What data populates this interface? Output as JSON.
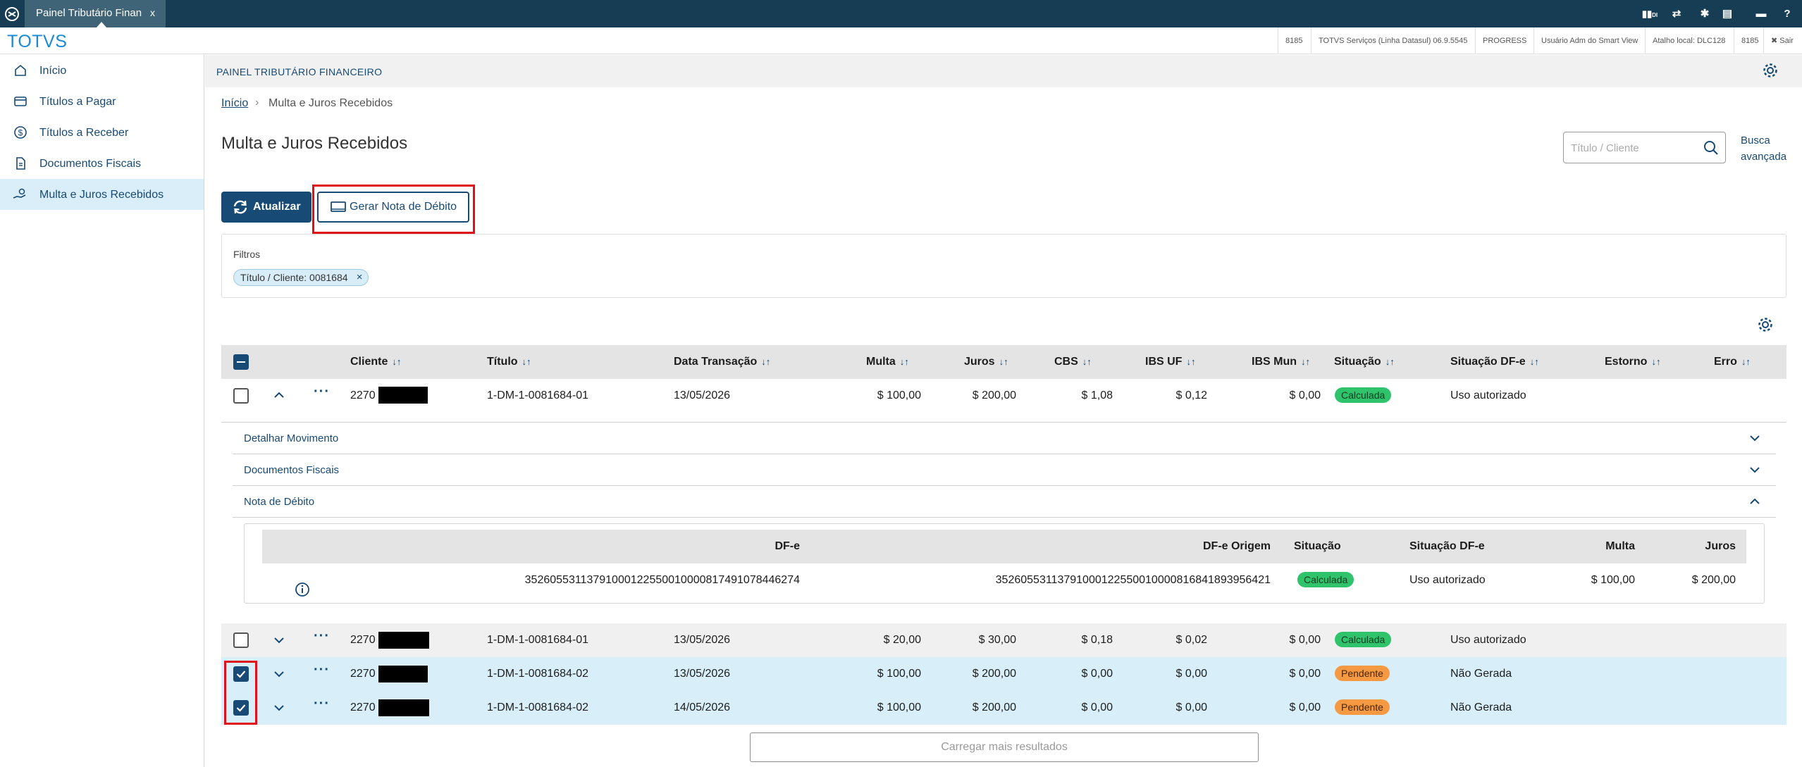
{
  "window": {
    "tab_title": "Painel Tributário Finan",
    "tab_close": "x"
  },
  "topbar_icons": [
    "signal-icon",
    "shuffle-icon",
    "gear-icon",
    "document-icon",
    "chat-icon",
    "help-icon"
  ],
  "topbar_signal_label": "DI",
  "header": {
    "logo": "TOTVS",
    "info": [
      "8185",
      "TOTVS Serviços (Linha Datasul) 06.9.5545",
      "PROGRESS",
      "Usuário Adm do Smart View",
      "Atalho local: DLC128",
      "8185",
      "Sair"
    ]
  },
  "sidebar": {
    "items": [
      {
        "label": "Início",
        "icon": "home-icon"
      },
      {
        "label": "Títulos a Pagar",
        "icon": "wallet-icon"
      },
      {
        "label": "Títulos a Receber",
        "icon": "dollar-icon"
      },
      {
        "label": "Documentos Fiscais",
        "icon": "document-icon"
      },
      {
        "label": "Multa e Juros Recebidos",
        "icon": "hand-money-icon"
      }
    ]
  },
  "page": {
    "section_title": "PAINEL TRIBUTÁRIO FINANCEIRO",
    "breadcrumb": {
      "home": "Início",
      "current": "Multa e Juros Recebidos"
    },
    "title": "Multa e Juros Recebidos",
    "search_placeholder": "Título / Cliente",
    "advanced_search": "Busca avançada",
    "buttons": {
      "refresh": "Atualizar",
      "generate": "Gerar Nota de Débito"
    },
    "filters": {
      "label": "Filtros",
      "chip": "Título / Cliente: 0081684"
    },
    "load_more": "Carregar mais resultados"
  },
  "table": {
    "columns": [
      "Cliente",
      "Título",
      "Data Transação",
      "Multa",
      "Juros",
      "CBS",
      "IBS UF",
      "IBS Mun",
      "Situação",
      "Situação DF-e",
      "Estorno",
      "Erro"
    ],
    "rows": [
      {
        "cliente": "2270",
        "titulo": "1-DM-1-0081684-01",
        "data": "13/05/2026",
        "multa": "$ 100,00",
        "juros": "$ 200,00",
        "cbs": "$ 1,08",
        "ibs_uf": "$ 0,12",
        "ibs_mun": "$ 0,00",
        "situacao": "Calculada",
        "situacao_dfe": "Uso autorizado",
        "checked": false,
        "expanded": true
      },
      {
        "cliente": "2270",
        "titulo": "1-DM-1-0081684-01",
        "data": "13/05/2026",
        "multa": "$ 20,00",
        "juros": "$ 30,00",
        "cbs": "$ 0,18",
        "ibs_uf": "$ 0,02",
        "ibs_mun": "$ 0,00",
        "situacao": "Calculada",
        "situacao_dfe": "Uso autorizado",
        "checked": false,
        "expanded": false
      },
      {
        "cliente": "2270",
        "titulo": "1-DM-1-0081684-02",
        "data": "13/05/2026",
        "multa": "$ 100,00",
        "juros": "$ 200,00",
        "cbs": "$ 0,00",
        "ibs_uf": "$ 0,00",
        "ibs_mun": "$ 0,00",
        "situacao": "Pendente",
        "situacao_dfe": "Não Gerada",
        "checked": true,
        "expanded": false
      },
      {
        "cliente": "2270",
        "titulo": "1-DM-1-0081684-02",
        "data": "14/05/2026",
        "multa": "$ 100,00",
        "juros": "$ 200,00",
        "cbs": "$ 0,00",
        "ibs_uf": "$ 0,00",
        "ibs_mun": "$ 0,00",
        "situacao": "Pendente",
        "situacao_dfe": "Não Gerada",
        "checked": true,
        "expanded": false
      }
    ]
  },
  "detail": {
    "sections": [
      "Detalhar Movimento",
      "Documentos Fiscais",
      "Nota de Débito"
    ],
    "sub_columns": [
      "DF-e",
      "DF-e Origem",
      "Situação",
      "Situação DF-e",
      "Multa",
      "Juros"
    ],
    "sub_row": {
      "dfe": "35260553113791000122550010000817491078446274",
      "dfe_origem": "35260553113791000122550010000816841893956421",
      "situacao": "Calculada",
      "situacao_dfe": "Uso autorizado",
      "multa": "$ 100,00",
      "juros": "$ 200,00"
    }
  },
  "colors": {
    "primary": "#174a74",
    "topbar": "#163d54",
    "logo": "#1b8ad1",
    "selected_row": "#d8eef9",
    "highlight": "#e0111b",
    "badge_green": "#2fc46b",
    "badge_orange": "#f59a43"
  }
}
